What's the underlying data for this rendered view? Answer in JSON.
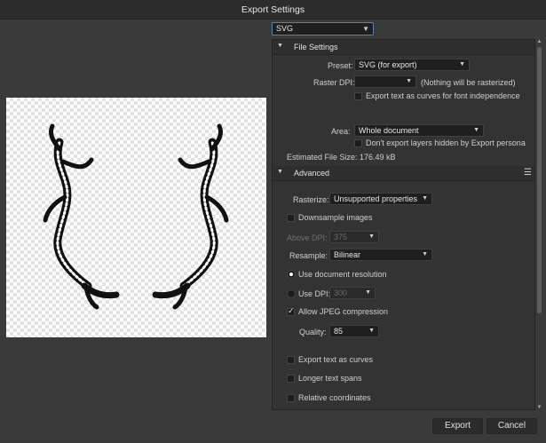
{
  "window": {
    "title": "Export Settings"
  },
  "format": {
    "value": "SVG",
    "icon": "chevron-down-icon"
  },
  "file_settings": {
    "header": "File Settings",
    "preset_label": "Preset:",
    "preset_value": "SVG (for export)",
    "raster_dpi_label": "Raster DPI:",
    "raster_dpi_value": "",
    "raster_note": "(Nothing will be rasterized)",
    "export_text_curves_label": "Export text as curves for font independence",
    "export_text_curves_checked": false,
    "area_label": "Area:",
    "area_value": "Whole document",
    "dont_export_hidden_label": "Don't export layers hidden by Export persona",
    "dont_export_hidden_checked": false,
    "estimated_size": "Estimated File Size: 176.49 kB"
  },
  "advanced": {
    "header": "Advanced",
    "rasterize_label": "Rasterize:",
    "rasterize_value": "Unsupported properties",
    "downsample_label": "Downsample images",
    "downsample_checked": false,
    "above_dpi_label": "Above DPI:",
    "above_dpi_value": "375",
    "resample_label": "Resample:",
    "resample_value": "Bilinear",
    "use_doc_res_label": "Use document resolution",
    "use_doc_res_selected": true,
    "use_dpi_label": "Use DPI:",
    "use_dpi_value": "300",
    "allow_jpeg_label": "Allow JPEG compression",
    "allow_jpeg_checked": true,
    "quality_label": "Quality:",
    "quality_value": "85",
    "export_text_curves_label": "Export text as curves",
    "longer_spans_label": "Longer text spans",
    "relative_coords_label": "Relative coordinates"
  },
  "buttons": {
    "export": "Export",
    "cancel": "Cancel"
  },
  "colors": {
    "accent": "#5b7fb0",
    "background": "#3a3a3a",
    "panel": "#333333"
  }
}
